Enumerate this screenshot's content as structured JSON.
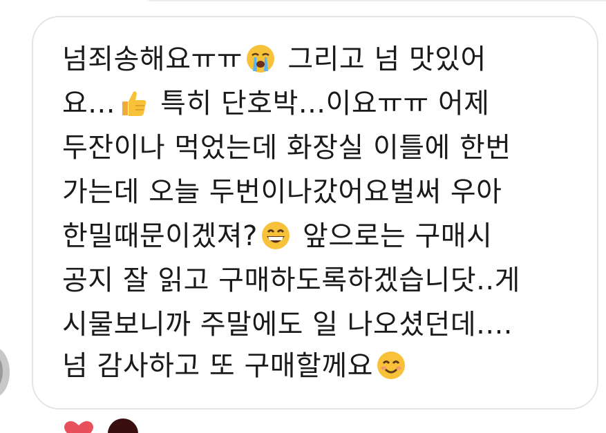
{
  "message": {
    "lines": [
      {
        "before": "넘죄송해요ㅠㅠ",
        "emoji": "crying-face-icon",
        "after": " 그리고 넘 맛있어"
      },
      {
        "before": "요...",
        "emoji": "thumbs-up-icon",
        "after": " 특히 단호박...이요ㅠㅠ 어제"
      },
      {
        "before": "두잔이나 먹었는데 화장실 이틀에 한번",
        "emoji": "",
        "after": ""
      },
      {
        "before": "가는데 오늘 두번이나갔어요벌써 우아",
        "emoji": "",
        "after": ""
      },
      {
        "before": "한밀때문이겠져?",
        "emoji": "grinning-face-icon",
        "after": " 앞으로는 구매시"
      },
      {
        "before": "공지 잘 읽고 구매하도록하겠습니닷..게",
        "emoji": "",
        "after": ""
      },
      {
        "before": "시물보니까 주말에도 일 나오셨던데....",
        "emoji": "",
        "after": ""
      },
      {
        "before": "넘 감사하고 또 구매할께요",
        "emoji": "smiling-face-icon",
        "after": ""
      }
    ]
  },
  "reactions": [
    {
      "icon": "heart-icon",
      "color": "#e8505b"
    },
    {
      "icon": "avatar-reaction-icon",
      "color": "#3a0f0f"
    }
  ],
  "colors": {
    "text": "#1a1a1a",
    "bubble_border": "#e4e4e4",
    "emoji_yellow": "#f7c23a"
  }
}
